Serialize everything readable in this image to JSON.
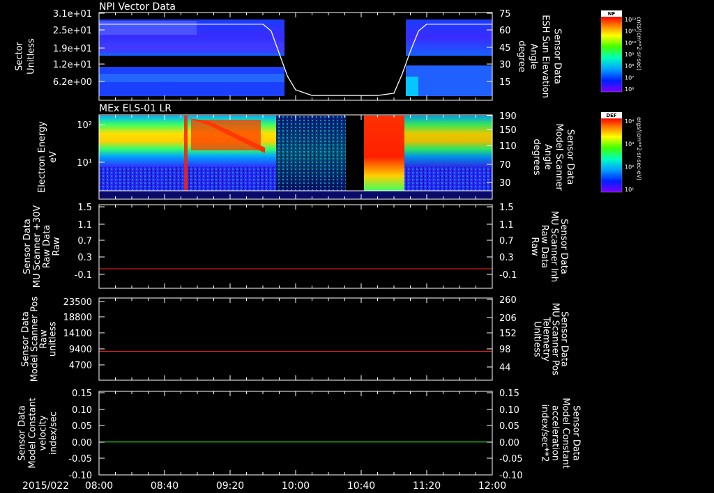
{
  "chart_data": [
    {
      "type": "heatmap",
      "title": "NPI Vector Data",
      "ylabel_left": [
        "Sector",
        "Unitless"
      ],
      "yticks_left": [
        "3.1e+01",
        "2.5e+01",
        "1.9e+01",
        "1.2e+01",
        "6.2e+00"
      ],
      "ylabel_right": [
        "Sensor Data",
        "ESH Sun Elevation",
        "Angle",
        "degree"
      ],
      "yticks_right": [
        "75",
        "60",
        "45",
        "30",
        "15"
      ],
      "ylim_right": [
        0,
        75
      ],
      "colorbar": {
        "title": "NF",
        "label": "cnts/(cm**2-sr-sec)",
        "ticks": [
          "10¹²",
          "10¹¹",
          "10¹⁰",
          "10⁹",
          "10⁸",
          "10⁷",
          "10⁶"
        ]
      },
      "overlay_line": {
        "color": "#ffffff",
        "x": [
          "08:00",
          "09:40",
          "09:45",
          "09:50",
          "09:55",
          "10:00",
          "10:10",
          "10:20",
          "10:30",
          "10:40",
          "10:50",
          "11:00",
          "11:05",
          "11:10",
          "11:15",
          "11:20",
          "12:00"
        ],
        "y": [
          66,
          66,
          60,
          40,
          20,
          8,
          3,
          3,
          3,
          3,
          3,
          5,
          22,
          42,
          60,
          66,
          66
        ]
      }
    },
    {
      "type": "heatmap",
      "title": "MEx ELS-01 LR",
      "ylabel_left": [
        "Electron Energy",
        "eV"
      ],
      "yticks_left": [
        "10²",
        "10¹"
      ],
      "ylabel_right": [
        "Sensor Data",
        "Model Scanner",
        "Angle",
        "degrees"
      ],
      "yticks_right": [
        "190",
        "150",
        "110",
        "70",
        "30"
      ],
      "colorbar": {
        "title": "DEF",
        "label": "ergs/(cm**2-sr-sec-eV)",
        "ticks": [
          "10⁴",
          "10³",
          "10²",
          "10¹"
        ]
      }
    },
    {
      "type": "line",
      "ylabel_left": [
        "Sensor Data",
        "MU Scanner +30V",
        "Raw Data",
        "Raw"
      ],
      "yticks_left": [
        "1.5",
        "1.1",
        "0.7",
        "0.3",
        "-0.1"
      ],
      "ylim": [
        -0.5,
        1.5
      ],
      "ylabel_right": [
        "Sensor Data",
        "MU Scanner Inh",
        "Raw Data",
        "Raw"
      ],
      "yticks_right": [
        "1.5",
        "1.1",
        "0.7",
        "0.3",
        "-0.1"
      ],
      "series": [
        {
          "color": "#ff2020",
          "x": [
            "08:00",
            "12:00"
          ],
          "y": [
            -0.5,
            -0.5
          ]
        }
      ]
    },
    {
      "type": "line",
      "ylabel_left": [
        "Sensor Data",
        "Model Scanner Pos",
        "Raw",
        "unitless"
      ],
      "yticks_left": [
        "23500",
        "18800",
        "14100",
        "9400",
        "4700"
      ],
      "ylim": [
        0,
        23500
      ],
      "ylabel_right": [
        "Sensor Data",
        "MU Scanner Pos",
        "Telemetry",
        "Unitless"
      ],
      "yticks_right": [
        "260",
        "206",
        "152",
        "98",
        "44"
      ],
      "series": [
        {
          "color": "#ff2020",
          "x": [
            "08:00",
            "12:00"
          ],
          "y": [
            8400,
            8400
          ]
        }
      ]
    },
    {
      "type": "line",
      "ylabel_left": [
        "Sensor Data",
        "Model Constant",
        "velocity",
        "index/sec"
      ],
      "yticks_left": [
        "0.15",
        "0.10",
        "0.05",
        "0.00",
        "-0.05",
        "-0.10"
      ],
      "ylim": [
        -0.1,
        0.15
      ],
      "ylabel_right": [
        "Sensor Data",
        "Model Constant",
        "acceleration",
        "index/sec**2"
      ],
      "yticks_right": [
        "0.15",
        "0.10",
        "0.05",
        "0.00",
        "-0.05",
        "-0.10"
      ],
      "series": [
        {
          "color": "#20ff20",
          "x": [
            "08:00",
            "12:00"
          ],
          "y": [
            0.0,
            0.0
          ]
        }
      ]
    }
  ],
  "x_axis": {
    "date_label": "2015/022",
    "ticks": [
      "08:00",
      "08:40",
      "09:20",
      "10:00",
      "10:40",
      "11:20",
      "12:00"
    ]
  },
  "colors": {
    "line_red": "#ff2020",
    "line_green": "#20ff20",
    "axis": "#ffffff",
    "background": "#000000"
  }
}
